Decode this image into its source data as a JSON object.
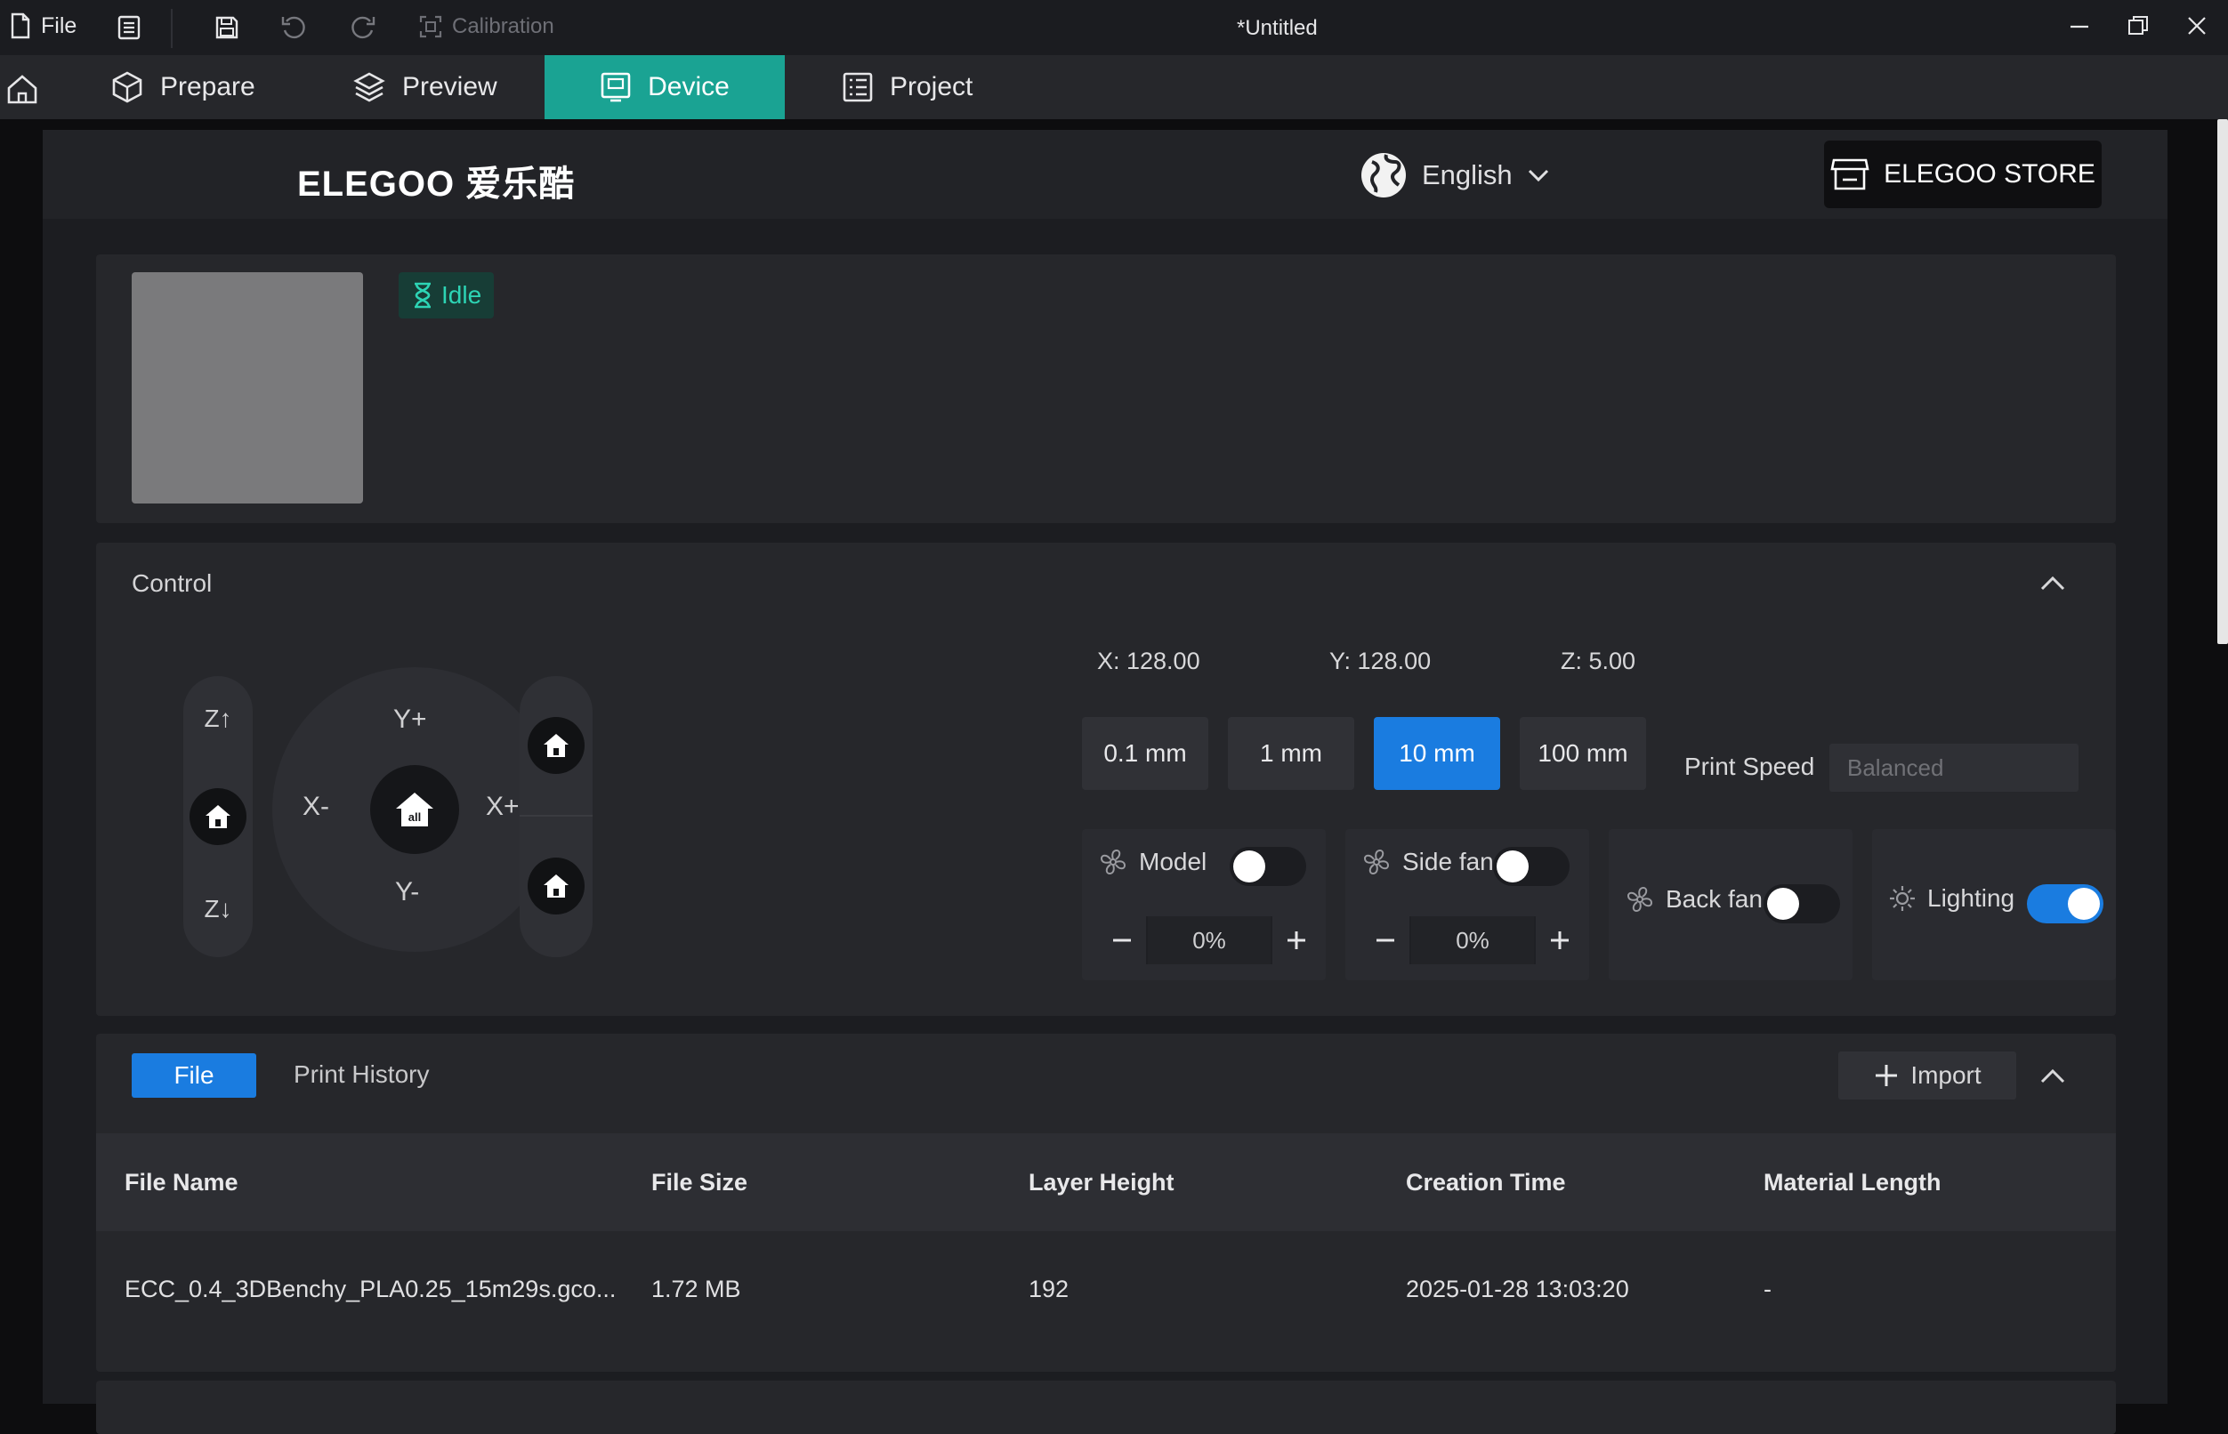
{
  "titlebar": {
    "file_label": "File",
    "calibration_label": "Calibration",
    "window_title": "*Untitled"
  },
  "nav": {
    "tabs": [
      {
        "label": "Prepare"
      },
      {
        "label": "Preview"
      },
      {
        "label": "Device"
      },
      {
        "label": "Project"
      }
    ],
    "active_tab": "Device",
    "accent": "#1aa393"
  },
  "header": {
    "logo": "ELEGOO 爱乐酷",
    "language": "English",
    "store_label": "ELEGOO STORE"
  },
  "device": {
    "status": "Idle",
    "status_color": "#2dd4b4"
  },
  "control": {
    "title": "Control",
    "z_up": "Z↑",
    "z_down": "Z↓",
    "y_plus": "Y+",
    "y_minus": "Y-",
    "x_minus": "X-",
    "x_plus": "X+",
    "center_home": "all",
    "coords": {
      "x": "X:  128.00",
      "y": "Y:  128.00",
      "z": "Z:  5.00"
    },
    "steps": [
      {
        "label": "0.1 mm"
      },
      {
        "label": "1 mm"
      },
      {
        "label": "10 mm"
      },
      {
        "label": "100 mm"
      }
    ],
    "active_step": "10 mm",
    "print_speed_label": "Print Speed",
    "print_speed_value": "Balanced",
    "fans": {
      "model": {
        "label": "Model",
        "on": false,
        "value": "0%"
      },
      "side": {
        "label": "Side fan",
        "on": false,
        "value": "0%"
      },
      "back": {
        "label": "Back fan",
        "on": false
      },
      "lighting": {
        "label": "Lighting",
        "on": true
      }
    },
    "accent": "#1a7ce0"
  },
  "files": {
    "tabs": {
      "file": "File",
      "history": "Print History"
    },
    "import_label": "Import",
    "columns": [
      "File Name",
      "File Size",
      "Layer Height",
      "Creation Time",
      "Material Length"
    ],
    "rows": [
      [
        "ECC_0.4_3DBenchy_PLA0.25_15m29s.gco...",
        "1.72 MB",
        "192",
        "2025-01-28 13:03:20",
        "-"
      ]
    ]
  }
}
